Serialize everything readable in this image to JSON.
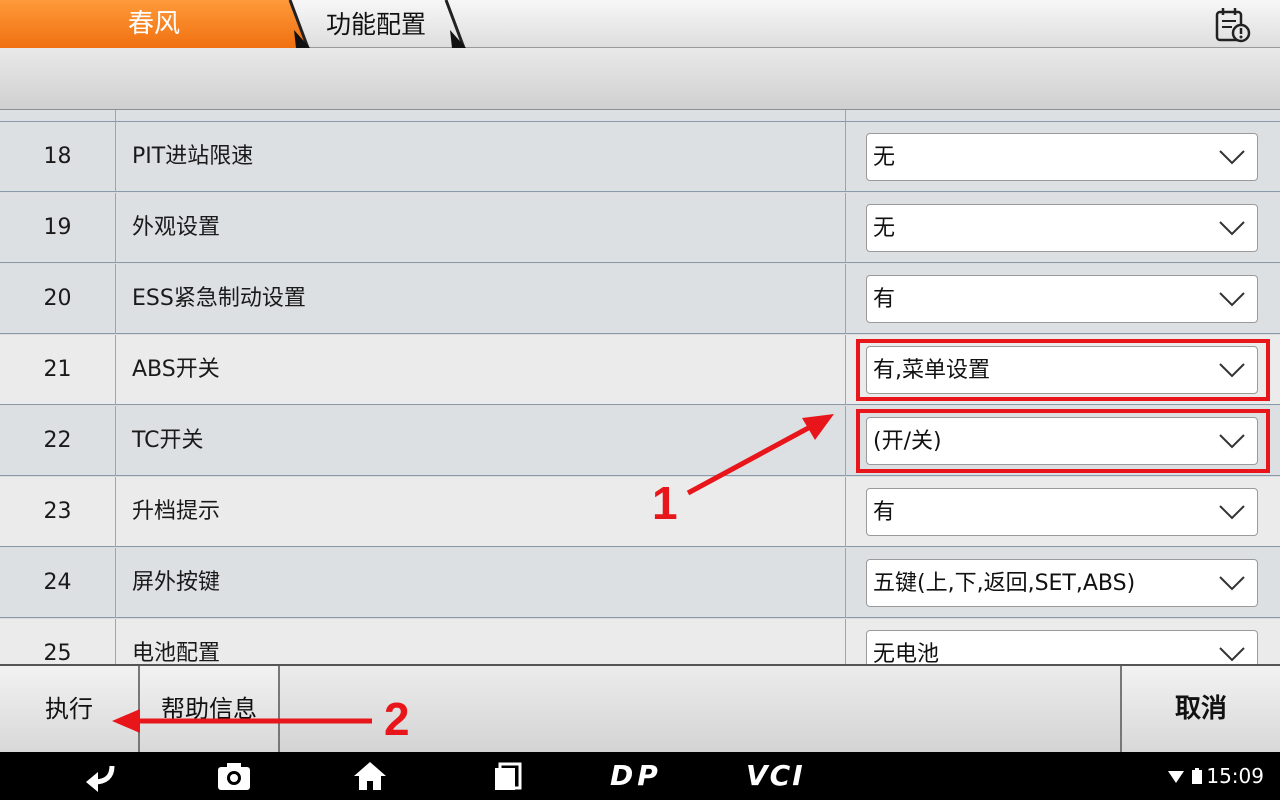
{
  "header": {
    "brand": "春风",
    "page": "功能配置",
    "brand_color": "#f47a20"
  },
  "table": {
    "rows": [
      {
        "num": "18",
        "name": "PIT进站限速",
        "value": "无"
      },
      {
        "num": "19",
        "name": "外观设置",
        "value": "无"
      },
      {
        "num": "20",
        "name": "ESS紧急制动设置",
        "value": "有"
      },
      {
        "num": "21",
        "name": "ABS开关",
        "value": "有,菜单设置"
      },
      {
        "num": "22",
        "name": "TC开关",
        "value": "(开/关)"
      },
      {
        "num": "23",
        "name": "升档提示",
        "value": "有"
      },
      {
        "num": "24",
        "name": "屏外按键",
        "value": "五键(上,下,返回,SET,ABS)"
      },
      {
        "num": "25",
        "name": "电池配置",
        "value": "无电池"
      }
    ]
  },
  "actions": {
    "execute": "执行",
    "help": "帮助信息",
    "cancel": "取消"
  },
  "annotations": {
    "label1": "1",
    "label2": "2",
    "color": "#e8161b"
  },
  "status": {
    "time": "15:09",
    "nav_dp": "DP",
    "nav_vci": "VCI"
  }
}
